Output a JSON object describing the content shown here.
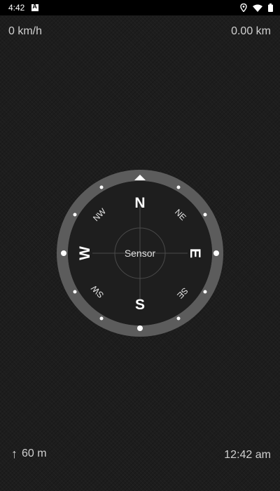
{
  "status_bar": {
    "time": "4:42",
    "icons": [
      "app-notification-icon",
      "location-icon",
      "wifi-icon",
      "battery-icon"
    ]
  },
  "speed": "0 km/h",
  "distance": "0.00 km",
  "altitude": {
    "icon": "arrow-up-icon",
    "value": "60 m"
  },
  "clock": "12:42 am",
  "compass": {
    "center_label": "Sensor",
    "cardinals": {
      "north": "N",
      "east": "E",
      "south": "S",
      "west": "W"
    },
    "intercardinals": {
      "northeast": "NE",
      "southeast": "SE",
      "southwest": "SW",
      "northwest": "NW"
    },
    "colors": {
      "bezel": "#5c5c5c",
      "dial": "#1e1e1e",
      "markings": "#ffffff"
    }
  }
}
